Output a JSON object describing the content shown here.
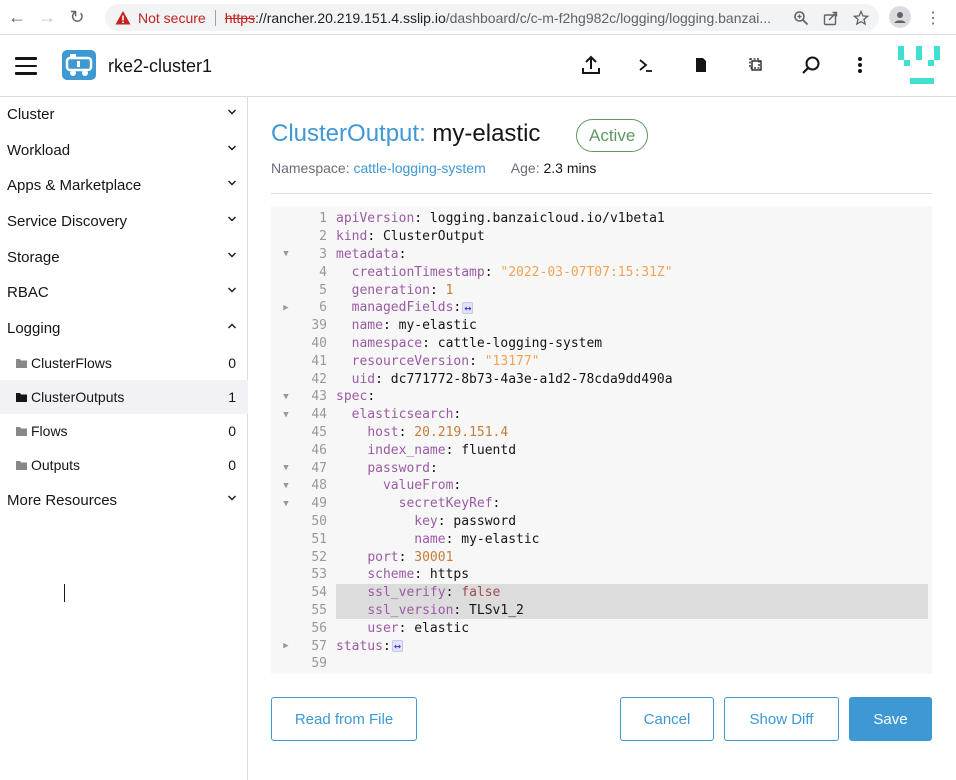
{
  "browser": {
    "security_label": "Not secure",
    "url_scheme": "https",
    "url_host": "://rancher.20.219.151.4.sslip.io",
    "url_path": "/dashboard/c/c-m-f2hg982c/logging/logging.banzai..."
  },
  "header": {
    "cluster_name": "rke2-cluster1"
  },
  "sidebar": {
    "groups": [
      {
        "label": "Cluster"
      },
      {
        "label": "Workload"
      },
      {
        "label": "Apps & Marketplace"
      },
      {
        "label": "Service Discovery"
      },
      {
        "label": "Storage"
      },
      {
        "label": "RBAC"
      },
      {
        "label": "Logging"
      }
    ],
    "logging_items": [
      {
        "label": "ClusterFlows",
        "count": "0"
      },
      {
        "label": "ClusterOutputs",
        "count": "1"
      },
      {
        "label": "Flows",
        "count": "0"
      },
      {
        "label": "Outputs",
        "count": "0"
      }
    ],
    "more_resources": "More Resources"
  },
  "main": {
    "kind_label": "ClusterOutput:",
    "name": "my-elastic",
    "state": "Active",
    "namespace_label": "Namespace:",
    "namespace_value": "cattle-logging-system",
    "age_label": "Age:",
    "age_value": "2.3 mins"
  },
  "editor": {
    "lines": [
      {
        "no": "1",
        "fold": "",
        "hl": false,
        "tokens": [
          [
            "key",
            "apiVersion"
          ],
          [
            "plain",
            ": logging.banzaicloud.io/v1beta1"
          ]
        ]
      },
      {
        "no": "2",
        "fold": "",
        "hl": false,
        "tokens": [
          [
            "key",
            "kind"
          ],
          [
            "plain",
            ": ClusterOutput"
          ]
        ]
      },
      {
        "no": "3",
        "fold": "open",
        "hl": false,
        "tokens": [
          [
            "key",
            "metadata"
          ],
          [
            "plain",
            ":"
          ]
        ]
      },
      {
        "no": "4",
        "fold": "",
        "hl": false,
        "tokens": [
          [
            "plain",
            "  "
          ],
          [
            "key",
            "creationTimestamp"
          ],
          [
            "plain",
            ": "
          ],
          [
            "str",
            "\"2022-03-07T07:15:31Z\""
          ]
        ]
      },
      {
        "no": "5",
        "fold": "",
        "hl": false,
        "tokens": [
          [
            "plain",
            "  "
          ],
          [
            "key",
            "generation"
          ],
          [
            "plain",
            ": "
          ],
          [
            "num",
            "1"
          ]
        ]
      },
      {
        "no": "6",
        "fold": "closed",
        "hl": false,
        "tokens": [
          [
            "plain",
            "  "
          ],
          [
            "key",
            "managedFields"
          ],
          [
            "plain",
            ":"
          ],
          [
            "fold",
            "↔"
          ]
        ]
      },
      {
        "no": "39",
        "fold": "",
        "hl": false,
        "tokens": [
          [
            "plain",
            "  "
          ],
          [
            "key",
            "name"
          ],
          [
            "plain",
            ": my-elastic"
          ]
        ]
      },
      {
        "no": "40",
        "fold": "",
        "hl": false,
        "tokens": [
          [
            "plain",
            "  "
          ],
          [
            "key",
            "namespace"
          ],
          [
            "plain",
            ": cattle-logging-system"
          ]
        ]
      },
      {
        "no": "41",
        "fold": "",
        "hl": false,
        "tokens": [
          [
            "plain",
            "  "
          ],
          [
            "key",
            "resourceVersion"
          ],
          [
            "plain",
            ": "
          ],
          [
            "str",
            "\"13177\""
          ]
        ]
      },
      {
        "no": "42",
        "fold": "",
        "hl": false,
        "tokens": [
          [
            "plain",
            "  "
          ],
          [
            "key",
            "uid"
          ],
          [
            "plain",
            ": dc771772-8b73-4a3e-a1d2-78cda9dd490a"
          ]
        ]
      },
      {
        "no": "43",
        "fold": "open",
        "hl": false,
        "tokens": [
          [
            "key",
            "spec"
          ],
          [
            "plain",
            ":"
          ]
        ]
      },
      {
        "no": "44",
        "fold": "open",
        "hl": false,
        "tokens": [
          [
            "plain",
            "  "
          ],
          [
            "key",
            "elasticsearch"
          ],
          [
            "plain",
            ":"
          ]
        ]
      },
      {
        "no": "45",
        "fold": "",
        "hl": false,
        "tokens": [
          [
            "plain",
            "    "
          ],
          [
            "key",
            "host"
          ],
          [
            "plain",
            ": "
          ],
          [
            "num",
            "20.219.151.4"
          ]
        ]
      },
      {
        "no": "46",
        "fold": "",
        "hl": false,
        "tokens": [
          [
            "plain",
            "    "
          ],
          [
            "key",
            "index_name"
          ],
          [
            "plain",
            ": fluentd"
          ]
        ]
      },
      {
        "no": "47",
        "fold": "open",
        "hl": false,
        "tokens": [
          [
            "plain",
            "    "
          ],
          [
            "key",
            "password"
          ],
          [
            "plain",
            ":"
          ]
        ]
      },
      {
        "no": "48",
        "fold": "open",
        "hl": false,
        "tokens": [
          [
            "plain",
            "      "
          ],
          [
            "key",
            "valueFrom"
          ],
          [
            "plain",
            ":"
          ]
        ]
      },
      {
        "no": "49",
        "fold": "open",
        "hl": false,
        "tokens": [
          [
            "plain",
            "        "
          ],
          [
            "key",
            "secretKeyRef"
          ],
          [
            "plain",
            ":"
          ]
        ]
      },
      {
        "no": "50",
        "fold": "",
        "hl": false,
        "tokens": [
          [
            "plain",
            "          "
          ],
          [
            "key",
            "key"
          ],
          [
            "plain",
            ": password"
          ]
        ]
      },
      {
        "no": "51",
        "fold": "",
        "hl": false,
        "tokens": [
          [
            "plain",
            "          "
          ],
          [
            "key",
            "name"
          ],
          [
            "plain",
            ": my-elastic"
          ]
        ]
      },
      {
        "no": "52",
        "fold": "",
        "hl": false,
        "tokens": [
          [
            "plain",
            "    "
          ],
          [
            "key",
            "port"
          ],
          [
            "plain",
            ": "
          ],
          [
            "num",
            "30001"
          ]
        ]
      },
      {
        "no": "53",
        "fold": "",
        "hl": false,
        "tokens": [
          [
            "plain",
            "    "
          ],
          [
            "key",
            "scheme"
          ],
          [
            "plain",
            ": https"
          ]
        ]
      },
      {
        "no": "54",
        "fold": "",
        "hl": true,
        "tokens": [
          [
            "plain",
            "    "
          ],
          [
            "key",
            "ssl_verify"
          ],
          [
            "plain",
            ": "
          ],
          [
            "bool",
            "false"
          ]
        ]
      },
      {
        "no": "55",
        "fold": "",
        "hl": true,
        "tokens": [
          [
            "plain",
            "    "
          ],
          [
            "key",
            "ssl_version"
          ],
          [
            "plain",
            ": TLSv1_2"
          ]
        ]
      },
      {
        "no": "56",
        "fold": "",
        "hl": false,
        "tokens": [
          [
            "plain",
            "    "
          ],
          [
            "key",
            "user"
          ],
          [
            "plain",
            ": elastic"
          ]
        ]
      },
      {
        "no": "57",
        "fold": "closed",
        "hl": false,
        "tokens": [
          [
            "key",
            "status"
          ],
          [
            "plain",
            ":"
          ],
          [
            "fold",
            "↔"
          ]
        ]
      },
      {
        "no": "59",
        "fold": "",
        "hl": false,
        "tokens": []
      }
    ]
  },
  "footer": {
    "read_from_file": "Read from File",
    "cancel": "Cancel",
    "show_diff": "Show Diff",
    "save": "Save"
  },
  "colors": {
    "accent": "#3d98d3",
    "active_badge": "#5d995d",
    "yaml_key": "#9a5ba3",
    "yaml_string": "#f0a357"
  }
}
